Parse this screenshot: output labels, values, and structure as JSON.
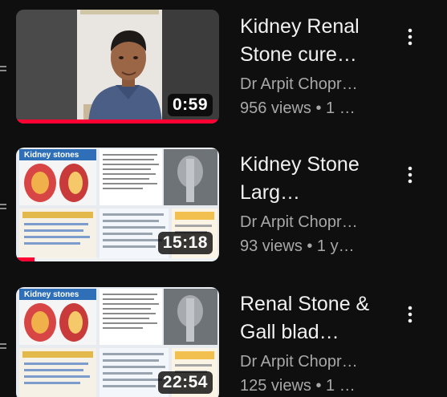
{
  "videos": [
    {
      "title": "Kidney Renal Stone cure…",
      "channel": "Dr Arpit Chopr…",
      "meta": "956 views • 1 …",
      "duration": "0:59",
      "watched_fraction": 1.0,
      "thumbnail": "doctor-portrait"
    },
    {
      "title": "Kidney Stone  Larg…",
      "channel": "Dr Arpit Chopr…",
      "meta": "93 views • 1 y…",
      "duration": "15:18",
      "watched_fraction": 0.09,
      "thumbnail_header": "Kidney stones"
    },
    {
      "title": "Renal Stone & Gall blad…",
      "channel": "Dr Arpit Chopr…",
      "meta": "125 views • 1 …",
      "duration": "22:54",
      "watched_fraction": 0.0,
      "thumbnail_header": "Kidney stones"
    }
  ],
  "colors": {
    "background": "#0f0f0f",
    "progress": "#ff0033",
    "title_text": "#f1f1f1",
    "secondary_text": "#a8a8a8"
  },
  "icons": {
    "more": "more-vert-icon"
  }
}
